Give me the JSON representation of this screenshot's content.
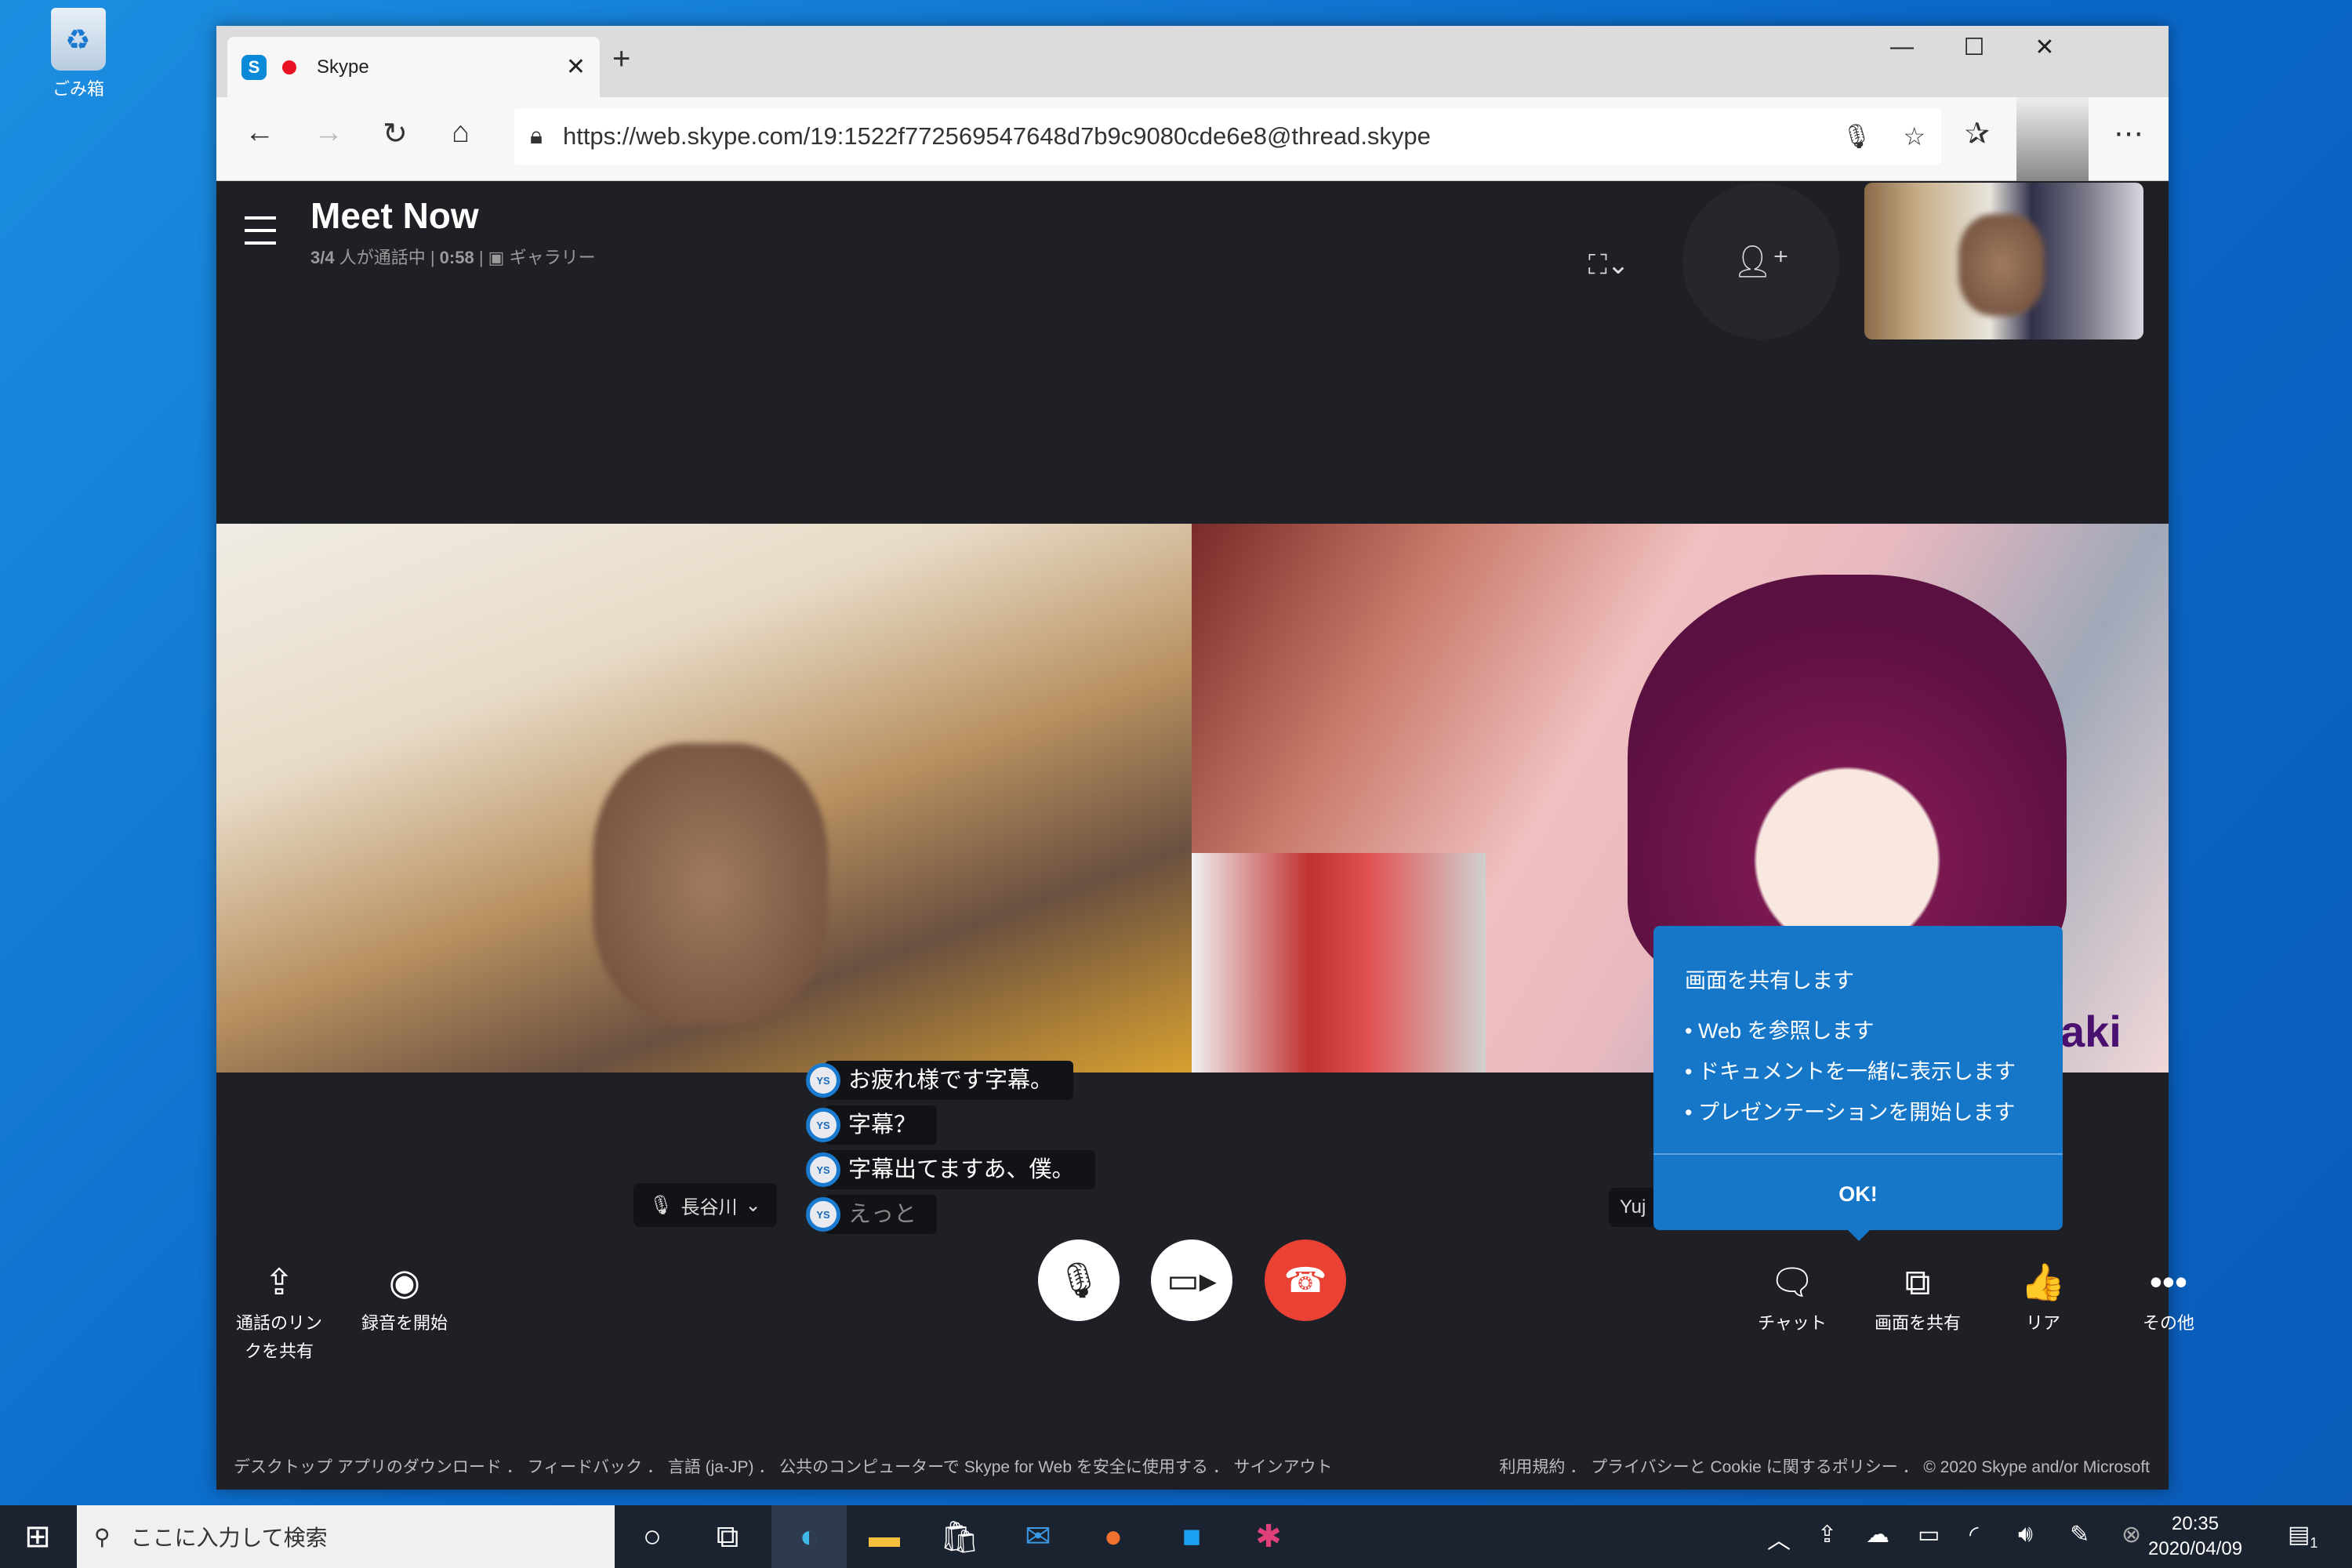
{
  "desktop": {
    "recycle_bin": "ごみ箱"
  },
  "browser": {
    "tab_title": "Skype",
    "url": "https://web.skype.com/19:1522f772569547648d7b9c9080cde6e8@thread.skype"
  },
  "call": {
    "title": "Meet Now",
    "participants": "3/4",
    "participants_suffix": " 人が通話中 | ",
    "duration": "0:58",
    "view_sep": " | ",
    "view": "ギャラリー"
  },
  "captions": [
    {
      "initials": "YS",
      "text": "お疲れ様です字幕。"
    },
    {
      "initials": "YS",
      "text": "字幕？"
    },
    {
      "initials": "YS",
      "text": "字幕出てますあ、僕。"
    },
    {
      "initials": "YS",
      "text": "えっと"
    }
  ],
  "name_chips": {
    "local": "長谷川",
    "remote": "Yuj"
  },
  "video_overlay_text": "aki",
  "controls": {
    "share_link": "通話のリンクを共有",
    "record": "録音を開始",
    "chat": "チャット",
    "share_screen": "画面を共有",
    "react": "リア",
    "more": "その他"
  },
  "tooltip": {
    "title": "画面を共有します",
    "items": [
      "Web を参照します",
      "ドキュメントを一緒に表示します",
      "プレゼンテーションを開始します"
    ],
    "ok": "OK!"
  },
  "footer": {
    "left": [
      "デスクトップ アプリのダウンロード",
      "フィードバック",
      "言語 (ja-JP)",
      "公共のコンピューターで Skype for Web を安全に使用する",
      "サインアウト"
    ],
    "right": [
      "利用規約",
      "プライバシーと Cookie に関するポリシー",
      "© 2020 Skype and/or Microsoft"
    ]
  },
  "taskbar": {
    "search_placeholder": "ここに入力して検索",
    "time": "20:35",
    "date": "2020/04/09",
    "notifications": "1"
  },
  "colors": {
    "accent": "#1677c8",
    "end_call": "#e94235",
    "background": "#1f2025"
  }
}
